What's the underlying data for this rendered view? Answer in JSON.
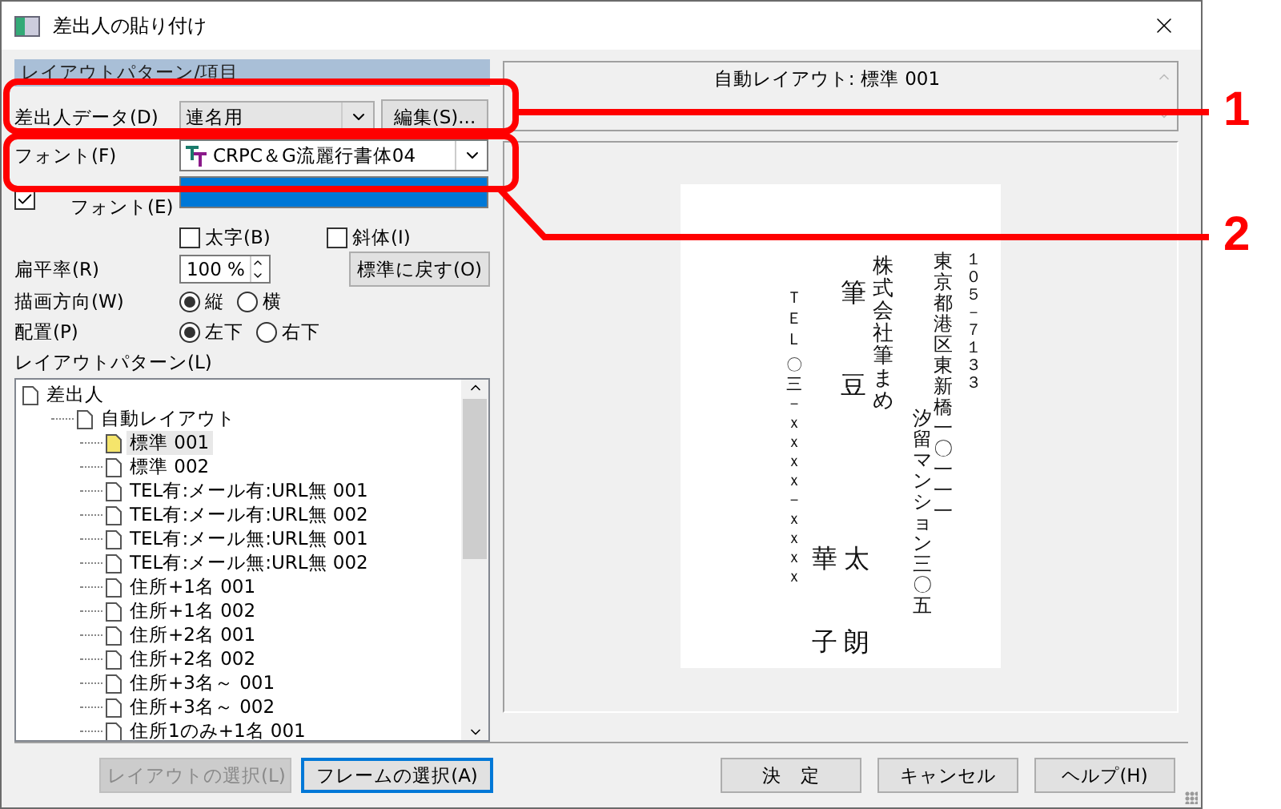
{
  "window": {
    "title": "差出人の貼り付け"
  },
  "left": {
    "header": "レイアウトパターン/項目",
    "sender_data": {
      "label": "差出人データ(D)",
      "value": "連名用",
      "button": "編集(S)..."
    },
    "font": {
      "label": "フォント(F)",
      "value": "CRPC＆G流麗行書体04"
    },
    "alnum_font": {
      "label_2": "フォント(E)",
      "checked": true
    },
    "styles": [
      {
        "label": "太字(B)",
        "checked": false
      },
      {
        "label": "斜体(I)",
        "checked": false
      }
    ],
    "ratio": {
      "label": "扁平率(R)",
      "value": "100 %",
      "button": "標準に戻す(O)"
    },
    "direction": {
      "label": "描画方向(W)",
      "options": [
        {
          "label": "縦",
          "selected": true
        },
        {
          "label": "横",
          "selected": false
        }
      ]
    },
    "placement": {
      "label": "配置(P)",
      "options": [
        {
          "label": "左下",
          "selected": true
        },
        {
          "label": "右下",
          "selected": false
        }
      ]
    },
    "pattern_label": "レイアウトパターン(L)",
    "tree": [
      {
        "label": "差出人",
        "children": [
          {
            "label": "自動レイアウト",
            "children": [
              {
                "label": "標準 001",
                "selected": true
              },
              {
                "label": "標準 002",
                "selected": false
              },
              {
                "label": "TEL有:メール有:URL無 001",
                "selected": false
              },
              {
                "label": "TEL有:メール有:URL無 002",
                "selected": false
              },
              {
                "label": "TEL有:メール無:URL無 001",
                "selected": false
              },
              {
                "label": "TEL有:メール無:URL無 002",
                "selected": false
              },
              {
                "label": "住所+1名 001",
                "selected": false
              },
              {
                "label": "住所+1名 002",
                "selected": false
              },
              {
                "label": "住所+2名 001",
                "selected": false
              },
              {
                "label": "住所+2名 002",
                "selected": false
              },
              {
                "label": "住所+3名～ 001",
                "selected": false
              },
              {
                "label": "住所+3名～ 002",
                "selected": false
              },
              {
                "label": "住所1のみ+1名 001",
                "selected": false
              }
            ]
          }
        ]
      }
    ]
  },
  "right": {
    "title": "自動レイアウト: 標準 001",
    "preview_lines": [
      "ＴＥＬ",
      "〇三－ｘｘｘｘ－ｘｘｘｘ",
      "華子",
      "筆",
      "豆",
      "太朗",
      "株式会社筆まめ",
      "汐留マンション三〇五",
      "東京都港区東新橋一〇一一一",
      "１０５－７１３３"
    ]
  },
  "buttons": [
    {
      "label": "レイアウトの選択(L)",
      "disabled": true,
      "default": false
    },
    {
      "label": "フレームの選択(A)",
      "disabled": false,
      "default": true
    },
    {
      "label": "決　定",
      "disabled": false,
      "default": false
    },
    {
      "label": "キャンセル",
      "disabled": false,
      "default": false
    },
    {
      "label": "ヘルプ(H)",
      "disabled": false,
      "default": false
    }
  ],
  "callouts": [
    {
      "label": "1"
    },
    {
      "label": "2"
    }
  ]
}
